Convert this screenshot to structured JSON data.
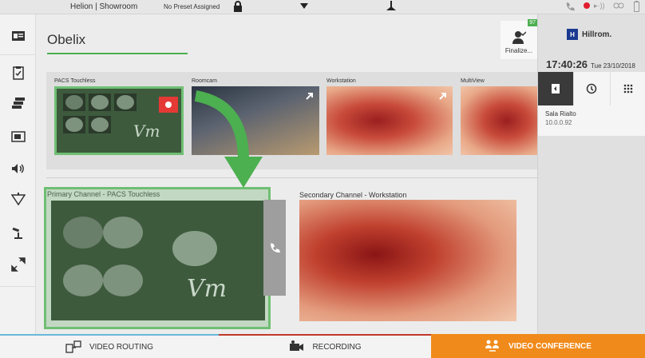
{
  "topbar": {
    "site": "Helion | Showroom",
    "preset": "No Preset Assigned"
  },
  "room": {
    "title": "Obelix"
  },
  "finalize": {
    "badge": "97",
    "label": "Finalize..."
  },
  "sources": [
    {
      "name": "PACS Touchless"
    },
    {
      "name": "Roomcam"
    },
    {
      "name": "Workstation"
    },
    {
      "name": "MultiView"
    }
  ],
  "channels": {
    "primary": "Primary Channel - PACS Touchless",
    "secondary": "Secondary Channel - Workstation"
  },
  "right_panel": {
    "brand": "Hillrom.",
    "time": "17:40:26",
    "date": "Tue 23/10/2018",
    "contact_name": "Sala Rialto",
    "contact_ip": "10.0.0.92"
  },
  "bottom": {
    "video_routing": "VIDEO ROUTING",
    "recording": "RECORDING",
    "video_conference": "VIDEO CONFERENCE"
  },
  "colors": {
    "accent_green": "#4caf50",
    "orange": "#f08a1a",
    "record_red": "#e11d2d"
  }
}
